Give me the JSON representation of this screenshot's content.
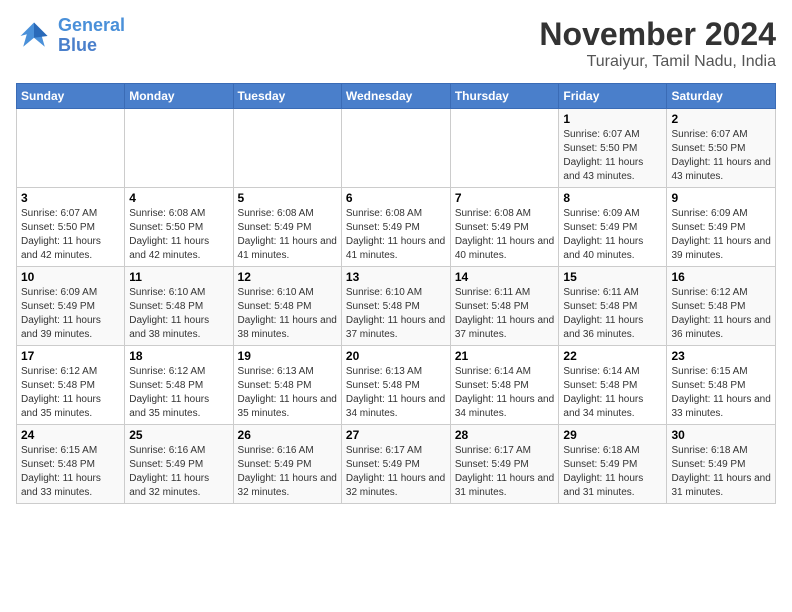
{
  "logo": {
    "text_general": "General",
    "text_blue": "Blue"
  },
  "title": "November 2024",
  "subtitle": "Turaiyur, Tamil Nadu, India",
  "weekdays": [
    "Sunday",
    "Monday",
    "Tuesday",
    "Wednesday",
    "Thursday",
    "Friday",
    "Saturday"
  ],
  "weeks": [
    [
      {
        "day": "",
        "info": ""
      },
      {
        "day": "",
        "info": ""
      },
      {
        "day": "",
        "info": ""
      },
      {
        "day": "",
        "info": ""
      },
      {
        "day": "",
        "info": ""
      },
      {
        "day": "1",
        "info": "Sunrise: 6:07 AM\nSunset: 5:50 PM\nDaylight: 11 hours and 43 minutes."
      },
      {
        "day": "2",
        "info": "Sunrise: 6:07 AM\nSunset: 5:50 PM\nDaylight: 11 hours and 43 minutes."
      }
    ],
    [
      {
        "day": "3",
        "info": "Sunrise: 6:07 AM\nSunset: 5:50 PM\nDaylight: 11 hours and 42 minutes."
      },
      {
        "day": "4",
        "info": "Sunrise: 6:08 AM\nSunset: 5:50 PM\nDaylight: 11 hours and 42 minutes."
      },
      {
        "day": "5",
        "info": "Sunrise: 6:08 AM\nSunset: 5:49 PM\nDaylight: 11 hours and 41 minutes."
      },
      {
        "day": "6",
        "info": "Sunrise: 6:08 AM\nSunset: 5:49 PM\nDaylight: 11 hours and 41 minutes."
      },
      {
        "day": "7",
        "info": "Sunrise: 6:08 AM\nSunset: 5:49 PM\nDaylight: 11 hours and 40 minutes."
      },
      {
        "day": "8",
        "info": "Sunrise: 6:09 AM\nSunset: 5:49 PM\nDaylight: 11 hours and 40 minutes."
      },
      {
        "day": "9",
        "info": "Sunrise: 6:09 AM\nSunset: 5:49 PM\nDaylight: 11 hours and 39 minutes."
      }
    ],
    [
      {
        "day": "10",
        "info": "Sunrise: 6:09 AM\nSunset: 5:49 PM\nDaylight: 11 hours and 39 minutes."
      },
      {
        "day": "11",
        "info": "Sunrise: 6:10 AM\nSunset: 5:48 PM\nDaylight: 11 hours and 38 minutes."
      },
      {
        "day": "12",
        "info": "Sunrise: 6:10 AM\nSunset: 5:48 PM\nDaylight: 11 hours and 38 minutes."
      },
      {
        "day": "13",
        "info": "Sunrise: 6:10 AM\nSunset: 5:48 PM\nDaylight: 11 hours and 37 minutes."
      },
      {
        "day": "14",
        "info": "Sunrise: 6:11 AM\nSunset: 5:48 PM\nDaylight: 11 hours and 37 minutes."
      },
      {
        "day": "15",
        "info": "Sunrise: 6:11 AM\nSunset: 5:48 PM\nDaylight: 11 hours and 36 minutes."
      },
      {
        "day": "16",
        "info": "Sunrise: 6:12 AM\nSunset: 5:48 PM\nDaylight: 11 hours and 36 minutes."
      }
    ],
    [
      {
        "day": "17",
        "info": "Sunrise: 6:12 AM\nSunset: 5:48 PM\nDaylight: 11 hours and 35 minutes."
      },
      {
        "day": "18",
        "info": "Sunrise: 6:12 AM\nSunset: 5:48 PM\nDaylight: 11 hours and 35 minutes."
      },
      {
        "day": "19",
        "info": "Sunrise: 6:13 AM\nSunset: 5:48 PM\nDaylight: 11 hours and 35 minutes."
      },
      {
        "day": "20",
        "info": "Sunrise: 6:13 AM\nSunset: 5:48 PM\nDaylight: 11 hours and 34 minutes."
      },
      {
        "day": "21",
        "info": "Sunrise: 6:14 AM\nSunset: 5:48 PM\nDaylight: 11 hours and 34 minutes."
      },
      {
        "day": "22",
        "info": "Sunrise: 6:14 AM\nSunset: 5:48 PM\nDaylight: 11 hours and 34 minutes."
      },
      {
        "day": "23",
        "info": "Sunrise: 6:15 AM\nSunset: 5:48 PM\nDaylight: 11 hours and 33 minutes."
      }
    ],
    [
      {
        "day": "24",
        "info": "Sunrise: 6:15 AM\nSunset: 5:48 PM\nDaylight: 11 hours and 33 minutes."
      },
      {
        "day": "25",
        "info": "Sunrise: 6:16 AM\nSunset: 5:49 PM\nDaylight: 11 hours and 32 minutes."
      },
      {
        "day": "26",
        "info": "Sunrise: 6:16 AM\nSunset: 5:49 PM\nDaylight: 11 hours and 32 minutes."
      },
      {
        "day": "27",
        "info": "Sunrise: 6:17 AM\nSunset: 5:49 PM\nDaylight: 11 hours and 32 minutes."
      },
      {
        "day": "28",
        "info": "Sunrise: 6:17 AM\nSunset: 5:49 PM\nDaylight: 11 hours and 31 minutes."
      },
      {
        "day": "29",
        "info": "Sunrise: 6:18 AM\nSunset: 5:49 PM\nDaylight: 11 hours and 31 minutes."
      },
      {
        "day": "30",
        "info": "Sunrise: 6:18 AM\nSunset: 5:49 PM\nDaylight: 11 hours and 31 minutes."
      }
    ]
  ]
}
